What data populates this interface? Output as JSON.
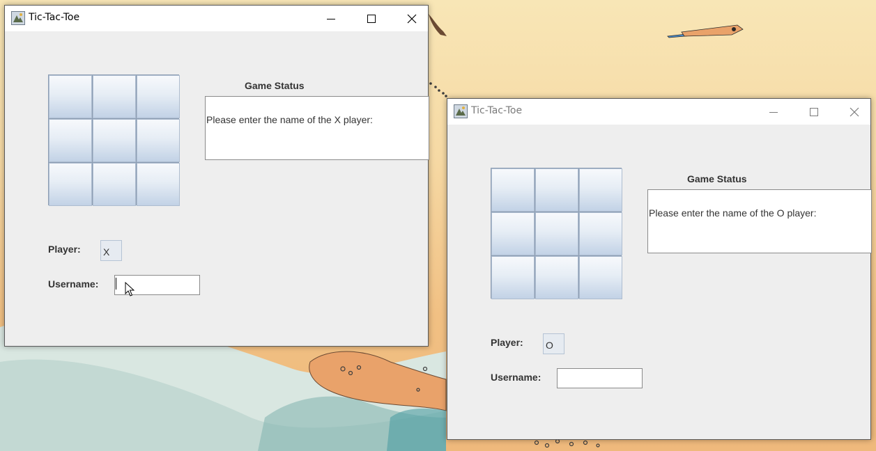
{
  "windows": [
    {
      "title": "Tic-Tac-Toe",
      "status_heading": "Game Status",
      "status_message": "Please enter the name of the X player:",
      "player_label": "Player:",
      "player_value": "X",
      "username_label": "Username:",
      "username_value": "",
      "board": [
        "",
        "",
        "",
        "",
        "",
        "",
        "",
        "",
        ""
      ],
      "active": true
    },
    {
      "title": "Tic-Tac-Toe",
      "status_heading": "Game Status",
      "status_message": "Please enter the name of the O player:",
      "player_label": "Player:",
      "player_value": "O",
      "username_label": "Username:",
      "username_value": "",
      "board": [
        "",
        "",
        "",
        "",
        "",
        "",
        "",
        "",
        ""
      ],
      "active": false
    }
  ],
  "icons": {
    "window_icon": "java-app-icon",
    "minimize": "minimize-icon",
    "maximize": "maximize-icon",
    "close": "close-icon",
    "pointer": "mouse-pointer-icon"
  },
  "colors": {
    "window_bg": "#eeeeee",
    "cell_gradient_top": "#f7f9fc",
    "cell_gradient_bottom": "#c2d2e6",
    "inactive_title": "#7a7a7a"
  }
}
